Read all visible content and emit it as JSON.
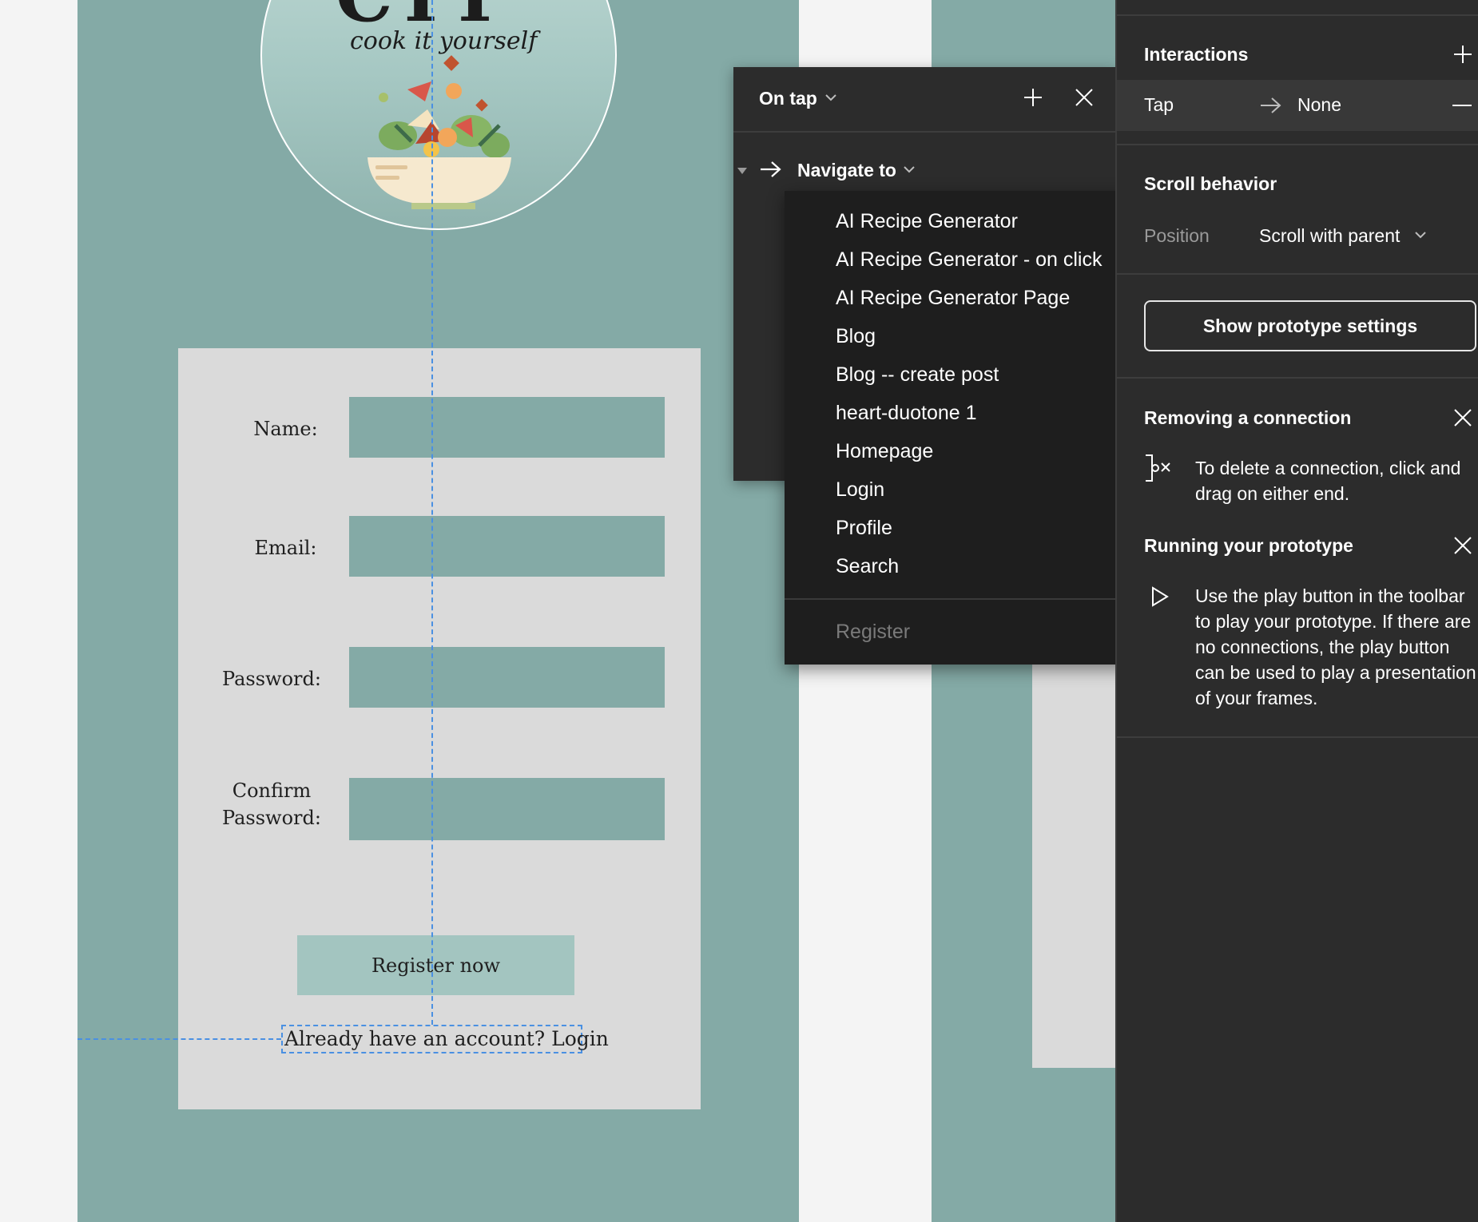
{
  "canvas": {
    "logo": {
      "title": "CIY",
      "tagline": "cook it yourself"
    },
    "form": {
      "name_label": "Name:",
      "email_label": "Email:",
      "password_label": "Password:",
      "confirm_label_line1": "Confirm",
      "confirm_label_line2": "Password:",
      "register_button": "Register now",
      "login_link": "Already have an account? Login"
    }
  },
  "interaction_popup": {
    "trigger": "On tap",
    "action": "Navigate to",
    "destinations": [
      "AI Recipe Generator",
      "AI Recipe Generator - on click",
      "AI Recipe Generator Page",
      "Blog",
      "Blog -- create post",
      "heart-duotone 1",
      "Homepage",
      "Login",
      "Profile",
      "Search"
    ],
    "disabled_destination": "Register"
  },
  "properties_panel": {
    "interactions": {
      "title": "Interactions",
      "trigger": "Tap",
      "destination": "None"
    },
    "scroll_behavior": {
      "title": "Scroll behavior",
      "position_label": "Position",
      "position_value": "Scroll with parent"
    },
    "prototype_settings_button": "Show prototype settings",
    "tips": {
      "removing_title": "Removing a connection",
      "removing_body": "To delete a connection, click and drag on either end.",
      "running_title": "Running your prototype",
      "running_body": "Use the play button in the toolbar to play your prototype. If there are no connections, the play button can be used to play a presentation of your frames."
    }
  },
  "colors": {
    "frame_teal": "#84aaa6",
    "card_gray": "#dadada",
    "button_teal": "#a3c5c0",
    "panel_dark": "#2c2c2c",
    "menu_dark": "#1e1e1e",
    "guide_blue": "#4a90e2"
  }
}
